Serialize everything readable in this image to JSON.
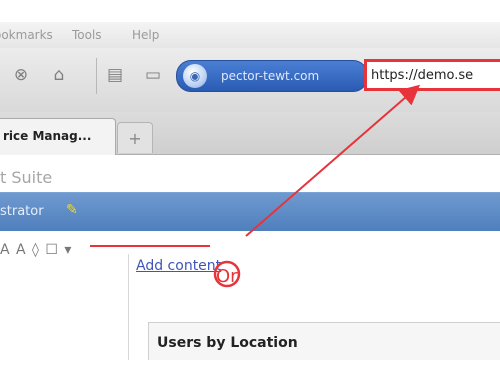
{
  "menu": {
    "items": [
      {
        "label": "ookmarks"
      },
      {
        "label": "Tools"
      },
      {
        "label": "Help"
      }
    ]
  },
  "toolbar": {
    "buttons": [
      {
        "icon": "stop-icon",
        "glyph": "⊗"
      },
      {
        "icon": "home-icon",
        "glyph": "⌂"
      },
      {
        "icon": "print-icon",
        "glyph": "▤"
      },
      {
        "icon": "screen-icon",
        "glyph": "▭"
      }
    ],
    "site_identity": "pector-tewt.com",
    "url": "https://demo.se"
  },
  "tabs": [
    {
      "label": "rice Manag..."
    }
  ],
  "new_tab_glyph": "+",
  "page": {
    "title": "t Suite",
    "user_label": "strator",
    "edit_tools": "A A ◊ ☐ ▾",
    "add_link": "Add content",
    "panel_title": "Users by Location"
  },
  "annotations": {
    "circle_letters": "Or",
    "color": "#e8333b"
  }
}
